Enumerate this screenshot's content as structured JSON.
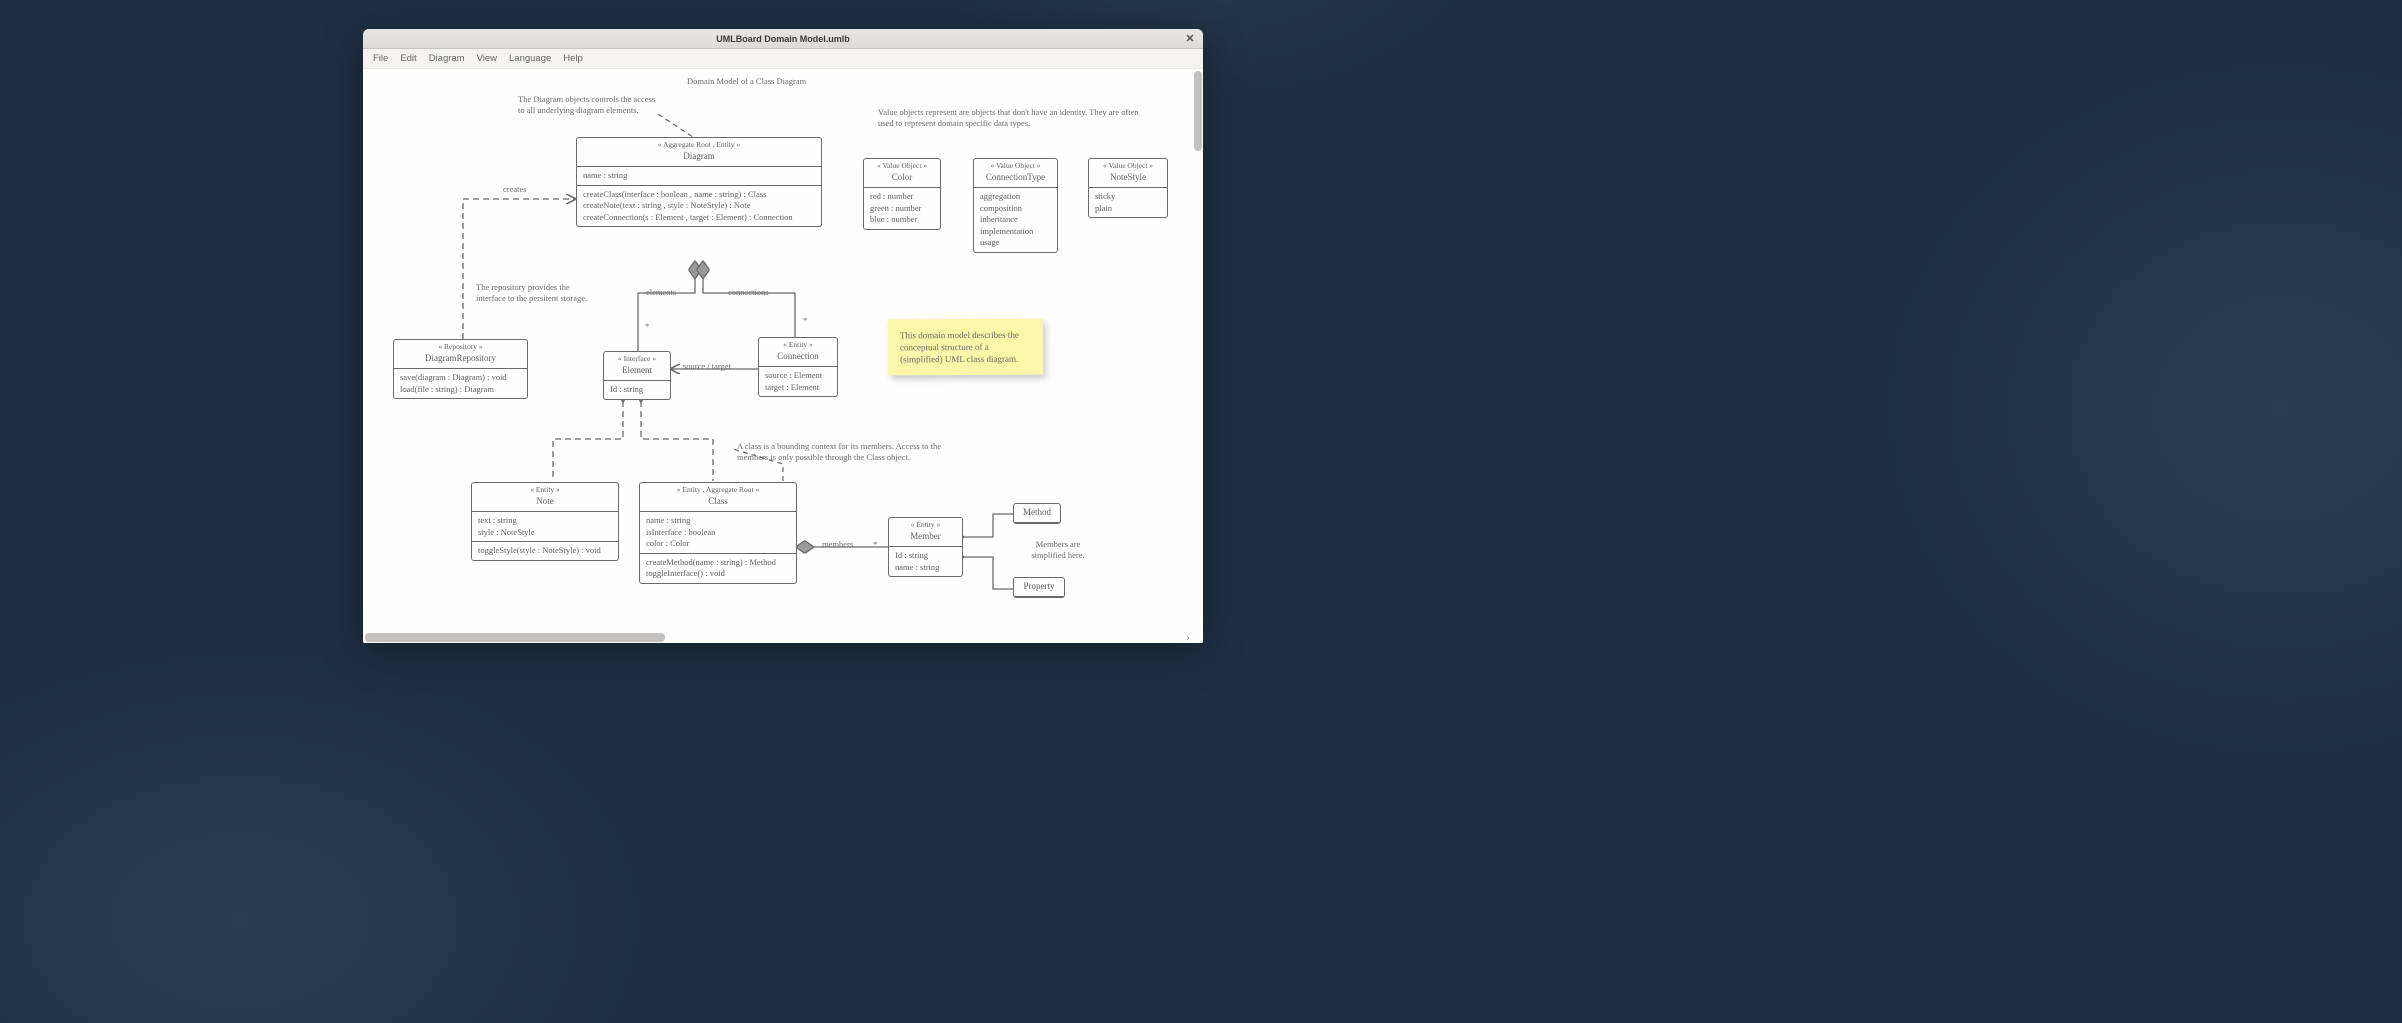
{
  "window": {
    "title": "UMLBoard Domain Model.umlb"
  },
  "menu": {
    "file": "File",
    "edit": "Edit",
    "diagram": "Diagram",
    "view": "View",
    "language": "Language",
    "help": "Help"
  },
  "diagram": {
    "title": "Domain Model of a Class Diagram",
    "notes": {
      "diagram_ctrl": "The Diagram objects controls the access to all underlying diagram elements.",
      "value_obj": "Value objects represent are objects that don't have an identity. They are often used to represent domain specific data types.",
      "repo": "The repository provides the interface to the persitent storage.",
      "class_bound": "A class is a bounding context for its members. Access to the members is only possible through the Class object.",
      "members_simplified": "Members are simplified here."
    },
    "labels": {
      "creates": "creates",
      "elements": "elements",
      "connections": "connections",
      "star1": "*",
      "star2": "*",
      "star3": "*",
      "source_target": "source / target",
      "members": "members"
    },
    "sticky": "This domain model describes the conceptual structure of a (simplified) UML class diagram.",
    "boxes": {
      "diagram": {
        "stereo": "« Aggregate Root , Entity »",
        "name": "Diagram",
        "attrs": [
          "name : string"
        ],
        "ops": [
          "createClass(interface : boolean , name : string) : Class",
          "createNote(text : string , style : NoteStyle) : Note",
          "createConnection(s : Element , target : Element) : Connection"
        ]
      },
      "repo": {
        "stereo": "« Repository »",
        "name": "DiagramRepository",
        "ops": [
          "save(diagram : Diagram) : void",
          "load(file : string) : Diagram"
        ]
      },
      "element": {
        "stereo": "« Interface »",
        "name": "Element",
        "attrs": [
          "Id : string"
        ]
      },
      "connection": {
        "stereo": "« Entity »",
        "name": "Connection",
        "attrs": [
          "source : Element",
          "target : Element"
        ]
      },
      "note": {
        "stereo": "« Entity »",
        "name": "Note",
        "attrs": [
          "text : string",
          "style : NoteStyle"
        ],
        "ops": [
          "toggleStyle(style : NoteStyle) : void"
        ]
      },
      "class": {
        "stereo": "« Entity , Aggregate Root »",
        "name": "Class",
        "attrs": [
          "name : string",
          "isInterface : boolean",
          "color : Color"
        ],
        "ops": [
          "createMethod(name : string) : Method",
          "toggleInterface() : void"
        ]
      },
      "member": {
        "stereo": "« Entity »",
        "name": "Member",
        "attrs": [
          "Id : string",
          "name : string"
        ]
      },
      "method": {
        "name": "Method"
      },
      "property": {
        "name": "Property"
      },
      "color": {
        "stereo": "« Value Object »",
        "name": "Color",
        "attrs": [
          "red : number",
          "green : number",
          "blue : number"
        ]
      },
      "conntype": {
        "stereo": "« Value Object »",
        "name": "ConnectionType",
        "attrs": [
          "aggregation",
          "composition",
          "inheritance",
          "implementation",
          "usage"
        ]
      },
      "notestyle": {
        "stereo": "« Value Object »",
        "name": "NoteStyle",
        "attrs": [
          "sticky",
          "plain"
        ]
      }
    }
  }
}
